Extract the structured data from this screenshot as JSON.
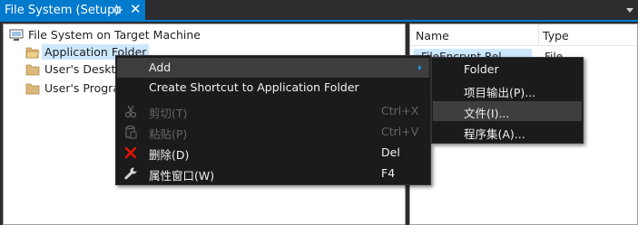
{
  "tab": {
    "title": "File System (Setup)",
    "pin_icon": "pin-icon",
    "close_glyph": "✕"
  },
  "tree": {
    "root_label": "File System on Target Machine",
    "items": [
      {
        "label": "Application Folder",
        "selected": true
      },
      {
        "label": "User's Desktop",
        "selected": false
      },
      {
        "label": "User's Programs Menu",
        "selected": false
      }
    ]
  },
  "list": {
    "columns": [
      "Name",
      "Type"
    ],
    "rows": [
      {
        "name": "FileEncrypt.Rel",
        "type": "File"
      }
    ]
  },
  "context_menu": {
    "items": [
      {
        "label": "Add",
        "shortcut": "",
        "disabled": false,
        "icon": ""
      },
      {
        "label": "Create Shortcut to Application Folder",
        "shortcut": "",
        "disabled": false,
        "icon": ""
      },
      {
        "label": "剪切(T)",
        "shortcut": "Ctrl+X",
        "disabled": true,
        "icon": "scissors-icon"
      },
      {
        "label": "粘贴(P)",
        "shortcut": "Ctrl+V",
        "disabled": true,
        "icon": "paste-icon"
      },
      {
        "label": "删除(D)",
        "shortcut": "Del",
        "disabled": false,
        "icon": "delete-x-icon"
      },
      {
        "label": "属性窗口(W)",
        "shortcut": "F4",
        "disabled": false,
        "icon": "wrench-icon"
      }
    ]
  },
  "submenu": {
    "items": [
      {
        "label": "Folder"
      },
      {
        "label": "项目输出(P)..."
      },
      {
        "label": "文件(I)..."
      },
      {
        "label": "程序集(A)..."
      }
    ]
  },
  "colors": {
    "accent": "#007acc",
    "menu_bg": "#1b1b1c",
    "menu_highlight": "#3e3e40",
    "selection": "#cce8ff",
    "delete_red": "#e51400"
  }
}
